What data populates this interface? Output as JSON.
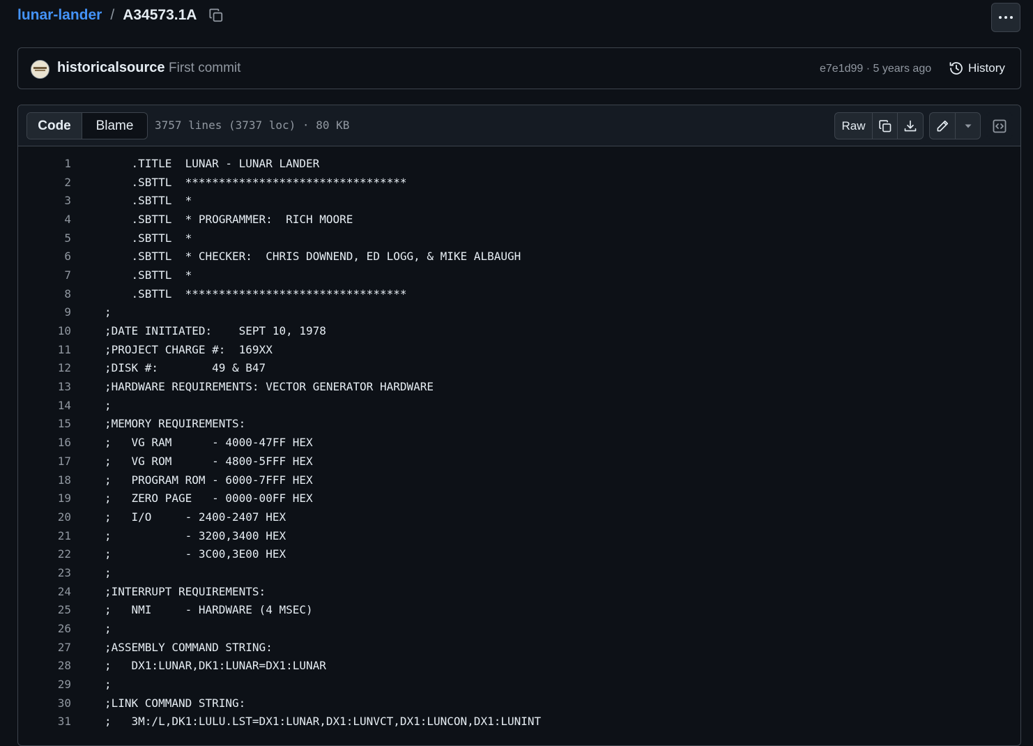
{
  "breadcrumb": {
    "repo": "lunar-lander",
    "separator": "/",
    "file": "A34573.1A"
  },
  "commit": {
    "author": "historicalsource",
    "message": "First commit",
    "meta": "e7e1d99 · 5 years ago",
    "history_label": "History"
  },
  "file": {
    "tabs": {
      "code": "Code",
      "blame": "Blame"
    },
    "info": "3757 lines (3737 loc) · 80 KB",
    "raw_label": "Raw"
  },
  "code_lines": [
    {
      "num": "1",
      "text": "    .TITLE  LUNAR - LUNAR LANDER"
    },
    {
      "num": "2",
      "text": "    .SBTTL  *********************************"
    },
    {
      "num": "3",
      "text": "    .SBTTL  *"
    },
    {
      "num": "4",
      "text": "    .SBTTL  * PROGRAMMER:  RICH MOORE"
    },
    {
      "num": "5",
      "text": "    .SBTTL  *"
    },
    {
      "num": "6",
      "text": "    .SBTTL  * CHECKER:  CHRIS DOWNEND, ED LOGG, & MIKE ALBAUGH"
    },
    {
      "num": "7",
      "text": "    .SBTTL  *"
    },
    {
      "num": "8",
      "text": "    .SBTTL  *********************************"
    },
    {
      "num": "9",
      "text": ";"
    },
    {
      "num": "10",
      "text": ";DATE INITIATED:    SEPT 10, 1978"
    },
    {
      "num": "11",
      "text": ";PROJECT CHARGE #:  169XX"
    },
    {
      "num": "12",
      "text": ";DISK #:        49 & B47"
    },
    {
      "num": "13",
      "text": ";HARDWARE REQUIREMENTS: VECTOR GENERATOR HARDWARE"
    },
    {
      "num": "14",
      "text": ";"
    },
    {
      "num": "15",
      "text": ";MEMORY REQUIREMENTS:"
    },
    {
      "num": "16",
      "text": ";   VG RAM      - 4000-47FF HEX"
    },
    {
      "num": "17",
      "text": ";   VG ROM      - 4800-5FFF HEX"
    },
    {
      "num": "18",
      "text": ";   PROGRAM ROM - 6000-7FFF HEX"
    },
    {
      "num": "19",
      "text": ";   ZERO PAGE   - 0000-00FF HEX"
    },
    {
      "num": "20",
      "text": ";   I/O     - 2400-2407 HEX"
    },
    {
      "num": "21",
      "text": ";           - 3200,3400 HEX"
    },
    {
      "num": "22",
      "text": ";           - 3C00,3E00 HEX"
    },
    {
      "num": "23",
      "text": ";"
    },
    {
      "num": "24",
      "text": ";INTERRUPT REQUIREMENTS:"
    },
    {
      "num": "25",
      "text": ";   NMI     - HARDWARE (4 MSEC)"
    },
    {
      "num": "26",
      "text": ";"
    },
    {
      "num": "27",
      "text": ";ASSEMBLY COMMAND STRING:"
    },
    {
      "num": "28",
      "text": ";   DX1:LUNAR,DK1:LUNAR=DX1:LUNAR"
    },
    {
      "num": "29",
      "text": ";"
    },
    {
      "num": "30",
      "text": ";LINK COMMAND STRING:"
    },
    {
      "num": "31",
      "text": ";   3M:/L,DK1:LULU.LST=DX1:LUNAR,DX1:LUNVCT,DX1:LUNCON,DX1:LUNINT"
    }
  ],
  "icons": {
    "copy_path": "copy-icon",
    "more": "kebab-horizontal-icon",
    "history": "history-icon",
    "copy_raw": "copy-icon",
    "download": "download-icon",
    "edit": "pencil-icon",
    "dropdown": "triangle-down-icon",
    "symbols": "code-square-icon"
  },
  "colors": {
    "background": "#0d1117",
    "link": "#4493f8",
    "border": "#3d444d",
    "muted": "#9198a1",
    "text": "#e6edf3"
  }
}
